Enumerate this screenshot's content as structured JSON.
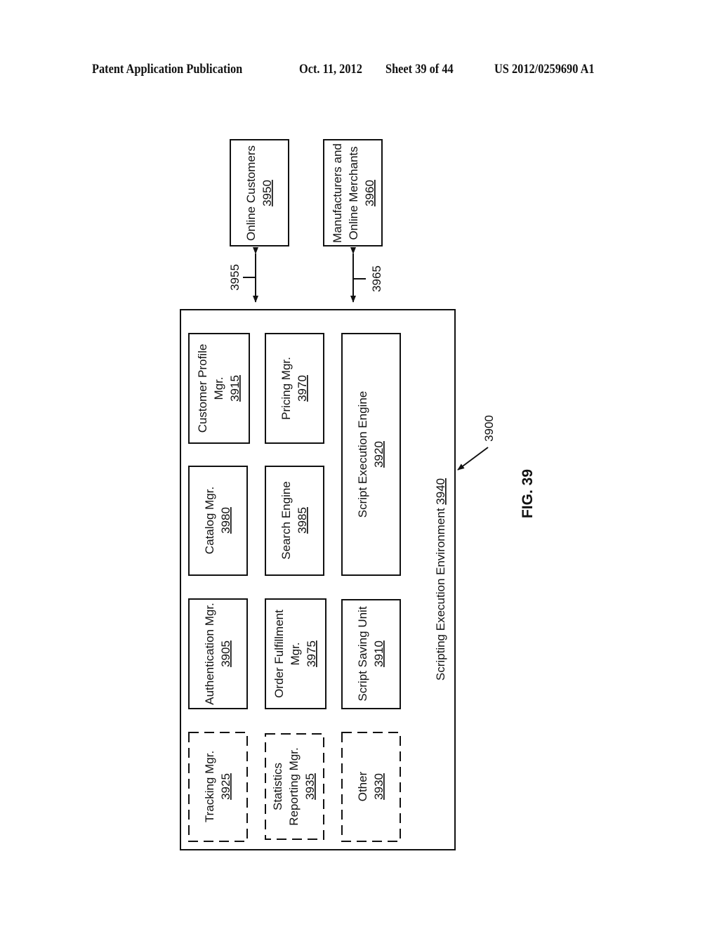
{
  "header": {
    "publication": "Patent Application Publication",
    "date": "Oct. 11, 2012",
    "sheet": "Sheet 39 of 44",
    "number": "US 2012/0259690 A1"
  },
  "figure": {
    "label": "FIG. 39",
    "system_ref": "3900",
    "environment": {
      "label": "Scripting Execution Environment",
      "ref": "3940"
    },
    "external": [
      {
        "id": "online-customers",
        "lines": [
          "Online Customers"
        ],
        "ref": "3950",
        "link_ref": "3955"
      },
      {
        "id": "manufacturers-merchants",
        "lines": [
          "Manufacturers and",
          "Online Merchants"
        ],
        "ref": "3960",
        "link_ref": "3965"
      }
    ],
    "modules": [
      {
        "id": "customer-profile-mgr",
        "lines": [
          "Customer Profile",
          "Mgr."
        ],
        "ref": "3915",
        "dashed": false
      },
      {
        "id": "pricing-mgr",
        "lines": [
          "Pricing Mgr."
        ],
        "ref": "3970",
        "dashed": false
      },
      {
        "id": "catalog-mgr",
        "lines": [
          "Catalog Mgr."
        ],
        "ref": "3980",
        "dashed": false
      },
      {
        "id": "search-engine",
        "lines": [
          "Search Engine"
        ],
        "ref": "3985",
        "dashed": false
      },
      {
        "id": "script-execution-engine",
        "lines": [
          "Script Execution Engine"
        ],
        "ref": "3920",
        "dashed": false
      },
      {
        "id": "authentication-mgr",
        "lines": [
          "Authentication Mgr."
        ],
        "ref": "3905",
        "dashed": false
      },
      {
        "id": "order-fulfillment-mgr",
        "lines": [
          "Order Fulfillment",
          "Mgr."
        ],
        "ref": "3975",
        "dashed": false
      },
      {
        "id": "script-saving-unit",
        "lines": [
          "Script Saving Unit"
        ],
        "ref": "3910",
        "dashed": false
      },
      {
        "id": "tracking-mgr",
        "lines": [
          "Tracking Mgr."
        ],
        "ref": "3925",
        "dashed": true
      },
      {
        "id": "statistics-reporting-mgr",
        "lines": [
          "Statistics",
          "Reporting Mgr."
        ],
        "ref": "3935",
        "dashed": true
      },
      {
        "id": "other",
        "lines": [
          "Other"
        ],
        "ref": "3930",
        "dashed": true
      }
    ]
  }
}
